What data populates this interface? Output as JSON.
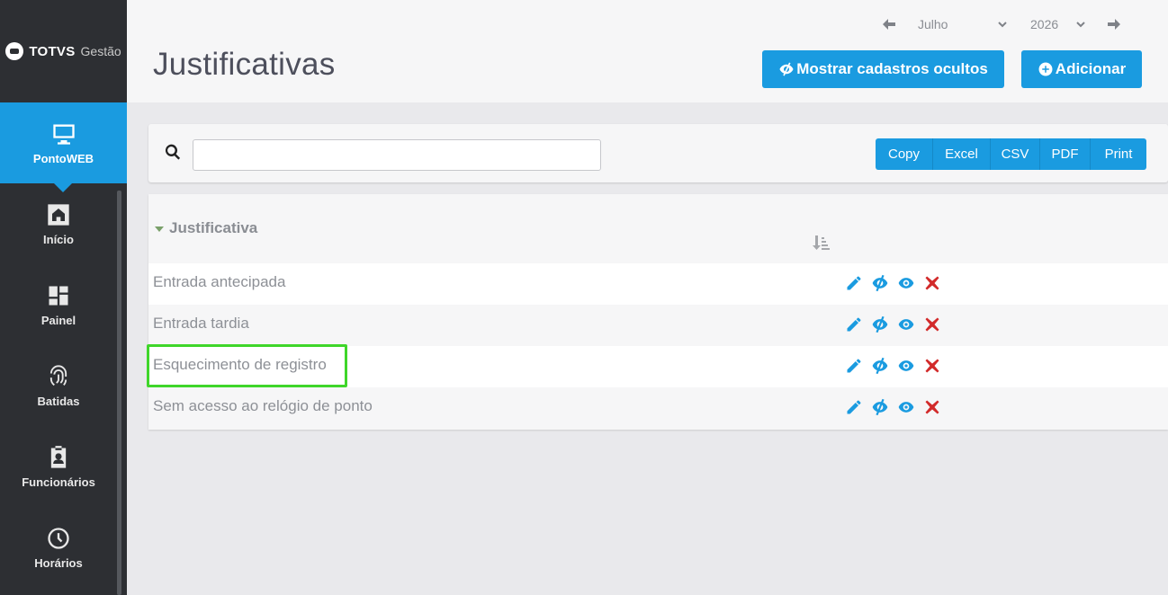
{
  "brand": {
    "name": "TOTVS",
    "sub": "Gestão"
  },
  "sidebar": {
    "items": [
      {
        "label": "PontoWEB",
        "icon": "monitor-icon",
        "active": true
      },
      {
        "label": "Início",
        "icon": "home-icon"
      },
      {
        "label": "Painel",
        "icon": "dashboard-icon"
      },
      {
        "label": "Batidas",
        "icon": "fingerprint-icon"
      },
      {
        "label": "Funcionários",
        "icon": "badge-icon"
      },
      {
        "label": "Horários",
        "icon": "clock-icon"
      }
    ]
  },
  "header": {
    "title": "Justificativas",
    "month": "Julho",
    "year": "2026",
    "show_hidden_label": "Mostrar cadastros ocultos",
    "add_label": "Adicionar"
  },
  "search": {
    "value": "",
    "placeholder": ""
  },
  "export_buttons": [
    "Copy",
    "Excel",
    "CSV",
    "PDF",
    "Print"
  ],
  "table": {
    "column_header": "Justificativa",
    "rows": [
      "Entrada antecipada",
      "Entrada tardia",
      "Esquecimento de registro",
      "Sem acesso ao relógio de ponto"
    ],
    "actions": [
      "edit-icon",
      "hide-icon",
      "view-icon",
      "delete-icon"
    ]
  },
  "colors": {
    "accent": "#1a9be0",
    "sidebar_bg": "#2d2f33",
    "delete": "#d22a2a",
    "highlight": "#3fd62a"
  }
}
